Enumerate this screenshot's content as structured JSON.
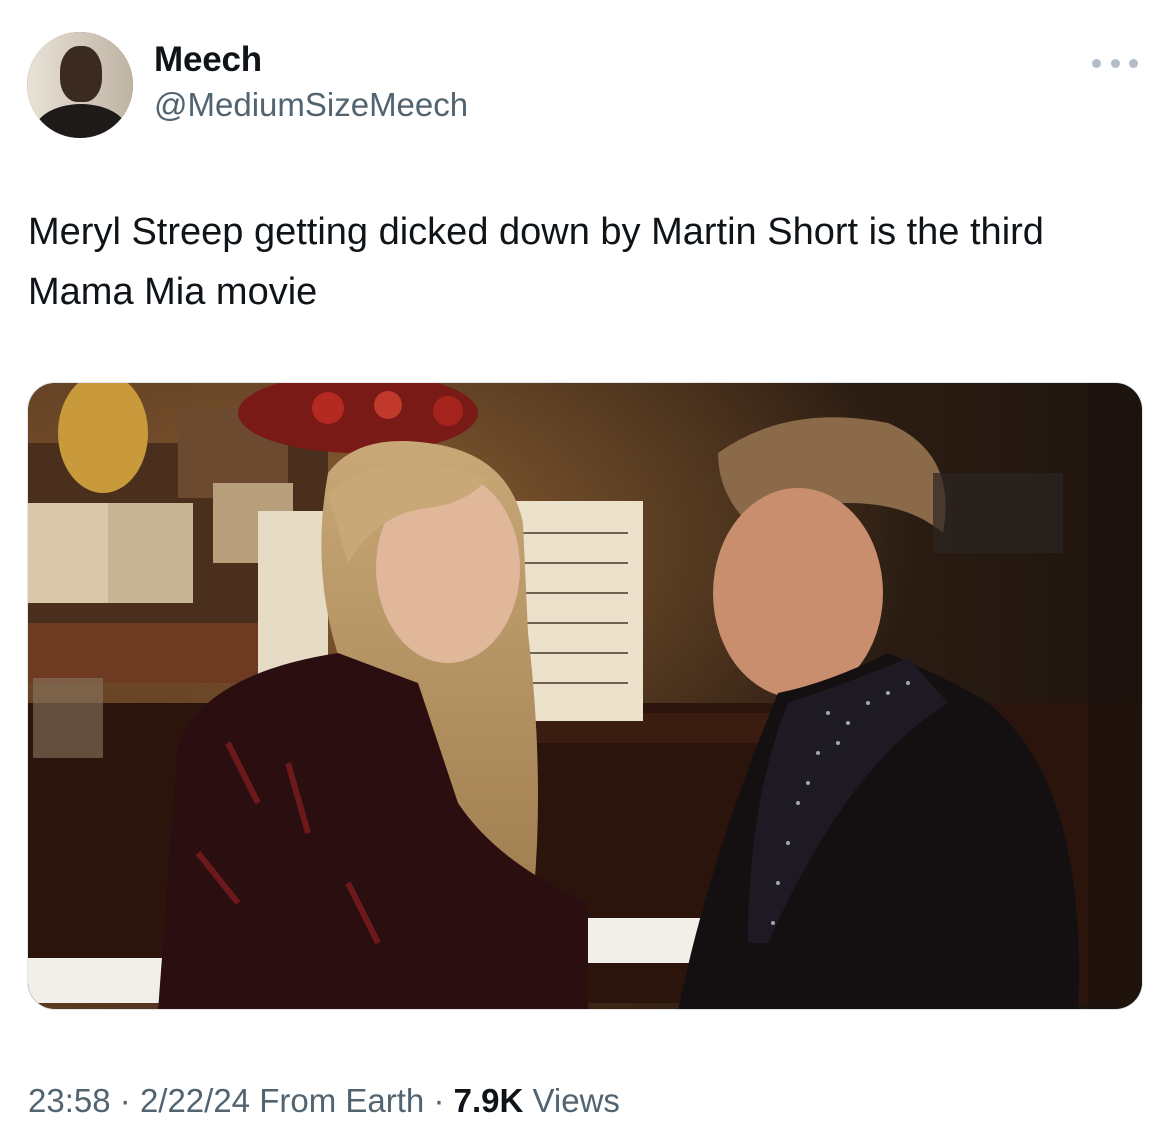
{
  "author": {
    "display_name": "Meech",
    "handle": "@MediumSizeMeech"
  },
  "tweet": {
    "text": "Meryl Streep getting dicked down by Martin Short is the third Mama Mia movie"
  },
  "meta": {
    "time": "23:58",
    "separator": "·",
    "date": "2/22/24",
    "source": "From Earth",
    "views_count": "7.9K",
    "views_label": "Views"
  },
  "icons": {
    "more": "more-horizontal-icon"
  }
}
